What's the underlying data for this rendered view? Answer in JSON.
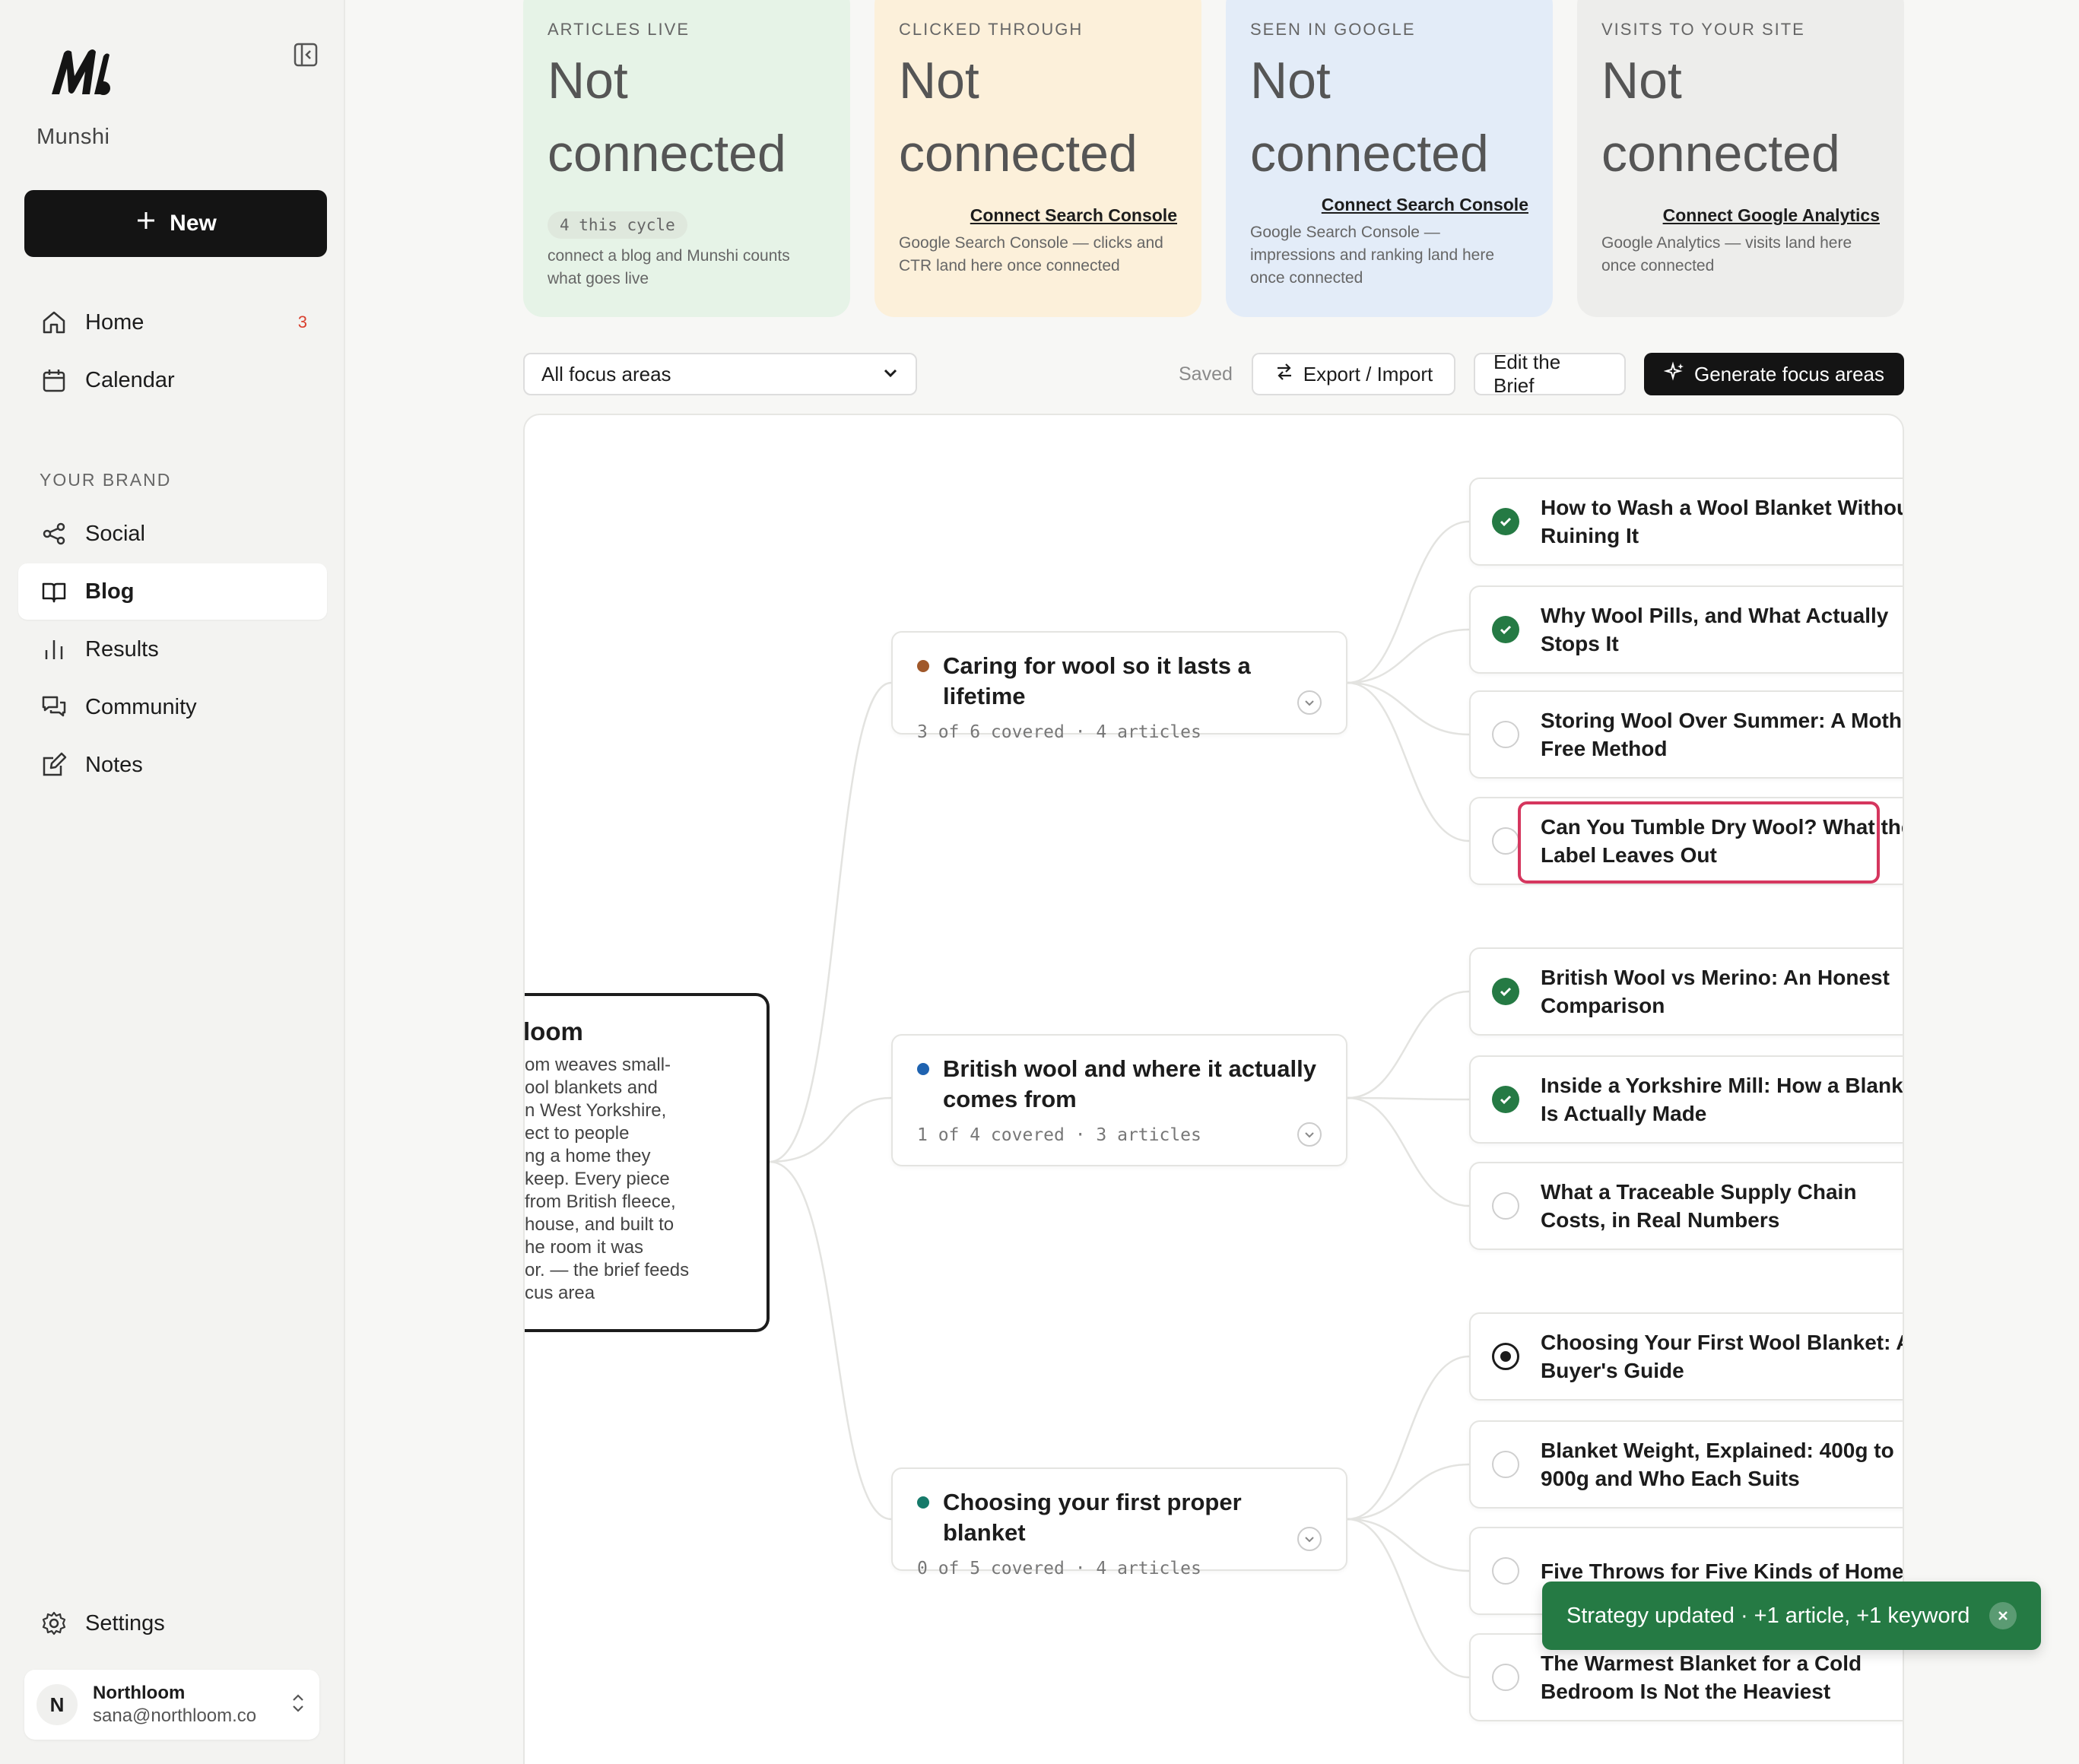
{
  "app": {
    "brand": "Munshi",
    "new_label": "New"
  },
  "sidebar": {
    "items": [
      {
        "label": "Home",
        "icon": "home-icon",
        "badge": "3"
      },
      {
        "label": "Calendar",
        "icon": "calendar-icon"
      }
    ],
    "section_label": "YOUR BRAND",
    "brand_items": [
      {
        "label": "Social",
        "icon": "share-icon"
      },
      {
        "label": "Blog",
        "icon": "book-icon",
        "active": true
      },
      {
        "label": "Results",
        "icon": "bar-chart-icon"
      },
      {
        "label": "Community",
        "icon": "chat-icon"
      },
      {
        "label": "Notes",
        "icon": "edit-icon"
      }
    ],
    "settings_label": "Settings",
    "account": {
      "initial": "N",
      "name": "Northloom",
      "email": "sana@northloom.co"
    }
  },
  "stats": [
    {
      "label": "ARTICLES LIVE",
      "value": "Not connected",
      "pill": "4 this cycle",
      "note": "connect a blog and Munshi counts what goes live",
      "bg": "#e6f3e7"
    },
    {
      "label": "CLICKED THROUGH",
      "value": "Not connected",
      "link": "Connect Search Console",
      "note": "Google Search Console — clicks and CTR land here once connected",
      "bg": "#fcf0da"
    },
    {
      "label": "SEEN IN GOOGLE",
      "value": "Not connected",
      "link": "Connect Search Console",
      "note": "Google Search Console — impressions and ranking land here once connected",
      "bg": "#e3ecf8"
    },
    {
      "label": "VISITS TO YOUR SITE",
      "value": "Not connected",
      "link": "Connect Google Analytics",
      "note": "Google Analytics — visits land here once connected",
      "bg": "#ededeb"
    }
  ],
  "toolbar": {
    "filter_value": "All focus areas",
    "saved": "Saved",
    "export_label": "Export / Import",
    "brief_label": "Edit the Brief",
    "generate_label": "Generate focus areas"
  },
  "brief": {
    "title_fragment": "loom",
    "text_lines": [
      "om weaves small-",
      "ool blankets and",
      "n West Yorkshire,",
      "ect to people",
      "ng a home they",
      "keep. Every piece",
      " from British fleece,",
      " house, and built to",
      "he room it was",
      "or. — the brief feeds",
      "cus area"
    ]
  },
  "focus_areas": [
    {
      "title": "Caring for wool so it lasts a lifetime",
      "meta": "3 of 6 covered · 4 articles",
      "color": "#a0582a"
    },
    {
      "title": "British wool and where it actually comes from",
      "meta": "1 of 4 covered · 3 articles",
      "color": "#1f63b0"
    },
    {
      "title": "Choosing your first proper blanket",
      "meta": "0 of 5 covered · 4 articles",
      "color": "#167a6a"
    }
  ],
  "articles": [
    {
      "title": "How to Wash a Wool Blanket Without Ruining It",
      "status": "done"
    },
    {
      "title": "Why Wool Pills, and What Actually Stops It",
      "status": "done"
    },
    {
      "title": "Storing Wool Over Summer: A Moth-Free Method",
      "status": "todo"
    },
    {
      "title": "Can You Tumble Dry Wool? What the Label Leaves Out",
      "status": "todo"
    },
    {
      "title": "British Wool vs Merino: An Honest Comparison",
      "status": "done"
    },
    {
      "title": "Inside a Yorkshire Mill: How a Blanket Is Actually Made",
      "status": "done"
    },
    {
      "title": "What a Traceable Supply Chain Costs, in Real Numbers",
      "status": "todo"
    },
    {
      "title": "Choosing Your First Wool Blanket: A Buyer's Guide",
      "status": "current"
    },
    {
      "title": "Blanket Weight, Explained: 400g to 900g and Who Each Suits",
      "status": "todo"
    },
    {
      "title": "Five Throws for Five Kinds of Homes",
      "status": "todo"
    },
    {
      "title": "The Warmest Blanket for a Cold Bedroom Is Not the Heaviest",
      "status": "todo"
    }
  ],
  "toast": {
    "message": "Strategy updated · +1 article, +1 keyword"
  }
}
